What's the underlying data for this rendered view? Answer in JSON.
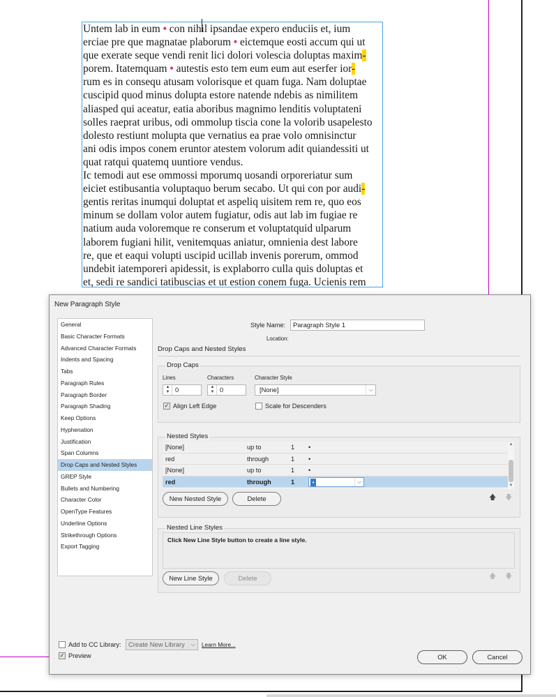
{
  "document": {
    "paragraph1": [
      {
        "t": "Untem lab in eum ",
        "dot": true,
        "t2": " con nihil ipsandae expero enduciis et, ium"
      },
      {
        "t": "erciae pre que magnatae plaborum ",
        "dot": true,
        "t2": " eictemque eosti accum qui ut"
      },
      {
        "t": "que exerate seque vendi renit lici dolori volescia doluptas maxim",
        "hy": "-"
      },
      {
        "t": "porem. Itatemquam ",
        "dot": true,
        "t2": " autestis esto tem eum eum aut eserfer ior",
        "hy": "-"
      },
      {
        "t": "rum es in consequ atusam volorisque et quam fuga. Nam doluptae"
      },
      {
        "t": "cuscipid quod minus dolupta estore natende ndebis as nimilitem"
      },
      {
        "t": "aliasped qui aceatur, eatia aboribus magnimo lenditis voluptateni"
      },
      {
        "t": "solles raeprat uribus, odi ommolup tiscia cone la volorib usapelesto"
      },
      {
        "t": "dolesto restiunt molupta que vernatius ea prae volo omnisinctur"
      },
      {
        "t": "ani odis impos conem eruntor atestem volorum adit quiandessiti ut"
      },
      {
        "t": "quat ratqui quatemq uuntiore vendus."
      }
    ],
    "paragraph2": [
      {
        "t": "Ic temodi aut ese ommossi mporumq uosandi orporeriatur sum"
      },
      {
        "t": "eiciet estibusantia voluptaquo berum secabo. Ut qui con por audi",
        "hy": "-"
      },
      {
        "t": "gentis reritas inumqui doluptat et aspeliq uisitem rem re, quo eos"
      },
      {
        "t": "minum se dollam volor autem fugiatur, odis aut lab im fugiae re"
      },
      {
        "t": "natium auda voloremque re conserum et voluptatquid ulparum"
      },
      {
        "t": "laborem fugiani hilit, venitemquas aniatur, omnienia dest labore"
      },
      {
        "t": "re, que et eaqui volupti uscipid ucillab invenis porerum, ommod"
      },
      {
        "t": "undebit iatemporeri apidessit, is explaborro culla quis doluptas et"
      },
      {
        "t": "et, sedi re sandici tatibuscias et ut estion conem fuga. Ucienis rem"
      }
    ],
    "dot_glyph": "•",
    "colors": {
      "frame": "#46a2e8",
      "dot": "#e0307a",
      "hyphen_highlight": "#ffd400",
      "guide": "#c000c0"
    }
  },
  "dialog": {
    "title": "New Paragraph Style",
    "categories": [
      "General",
      "Basic Character Formats",
      "Advanced Character Formats",
      "Indents and Spacing",
      "Tabs",
      "Paragraph Rules",
      "Paragraph Border",
      "Paragraph Shading",
      "Keep Options",
      "Hyphenation",
      "Justification",
      "Span Columns",
      "Drop Caps and Nested Styles",
      "GREP Style",
      "Bullets and Numbering",
      "Character Color",
      "OpenType Features",
      "Underline Options",
      "Strikethrough Options",
      "Export Tagging"
    ],
    "selected_category": "Drop Caps and Nested Styles",
    "style_name_label": "Style Name:",
    "style_name_value": "Paragraph Style 1",
    "location_label": "Location:",
    "section_title": "Drop Caps and Nested Styles",
    "drop_caps": {
      "title": "Drop Caps",
      "lines_label": "Lines",
      "lines_value": "0",
      "characters_label": "Characters",
      "characters_value": "0",
      "character_style_label": "Character Style",
      "character_style_value": "[None]",
      "align_left_edge_label": "Align Left Edge",
      "align_left_edge_checked": true,
      "scale_descenders_label": "Scale for Descenders",
      "scale_descenders_checked": false
    },
    "nested_styles": {
      "title": "Nested Styles",
      "rows": [
        {
          "style": "[None]",
          "mode": "up to",
          "count": "1",
          "delim": "•"
        },
        {
          "style": "red",
          "mode": "through",
          "count": "1",
          "delim": "•"
        },
        {
          "style": "[None]",
          "mode": "up to",
          "count": "1",
          "delim": "•"
        },
        {
          "style": "red",
          "mode": "through",
          "count": "1",
          "delim": "•"
        }
      ],
      "selected_row": 3,
      "new_button": "New Nested Style",
      "delete_button": "Delete"
    },
    "nested_line_styles": {
      "title": "Nested Line Styles",
      "message": "Click New Line Style button to create a line style.",
      "new_button": "New Line Style",
      "delete_button": "Delete"
    },
    "footer": {
      "add_cc_label": "Add to CC Library:",
      "add_cc_checked": false,
      "library_value": "Create New Library",
      "learn_more": "Learn More...",
      "preview_label": "Preview",
      "preview_checked": true,
      "ok_button": "OK",
      "cancel_button": "Cancel"
    }
  }
}
